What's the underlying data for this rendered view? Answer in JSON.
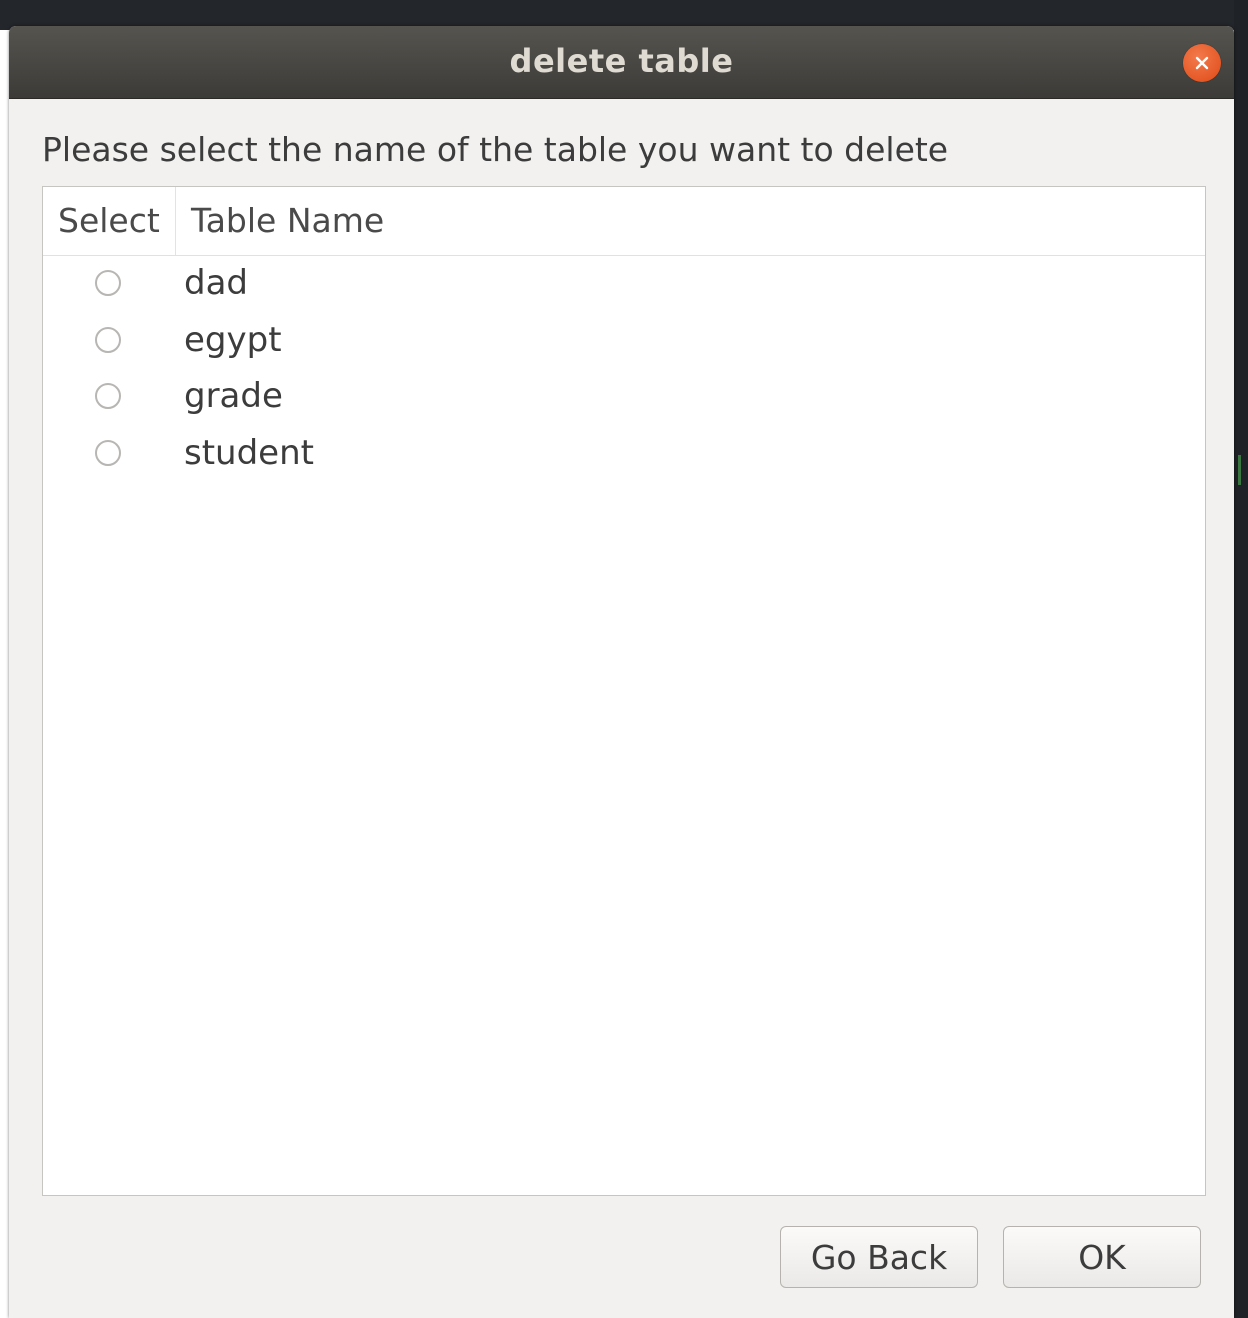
{
  "window": {
    "title": "delete table"
  },
  "dialog": {
    "instruction": "Please select the name of the table you want to delete",
    "columns": {
      "select": "Select",
      "name": "Table Name"
    },
    "tables": [
      {
        "name": "dad",
        "selected": false
      },
      {
        "name": "egypt",
        "selected": false
      },
      {
        "name": "grade",
        "selected": false
      },
      {
        "name": "student",
        "selected": false
      }
    ],
    "buttons": {
      "back": "Go Back",
      "ok": "OK"
    }
  },
  "colors": {
    "titlebar": "#3c3b37",
    "close": "#e95420",
    "window_bg": "#f2f1f0"
  },
  "icons": {
    "close": "close-icon"
  }
}
